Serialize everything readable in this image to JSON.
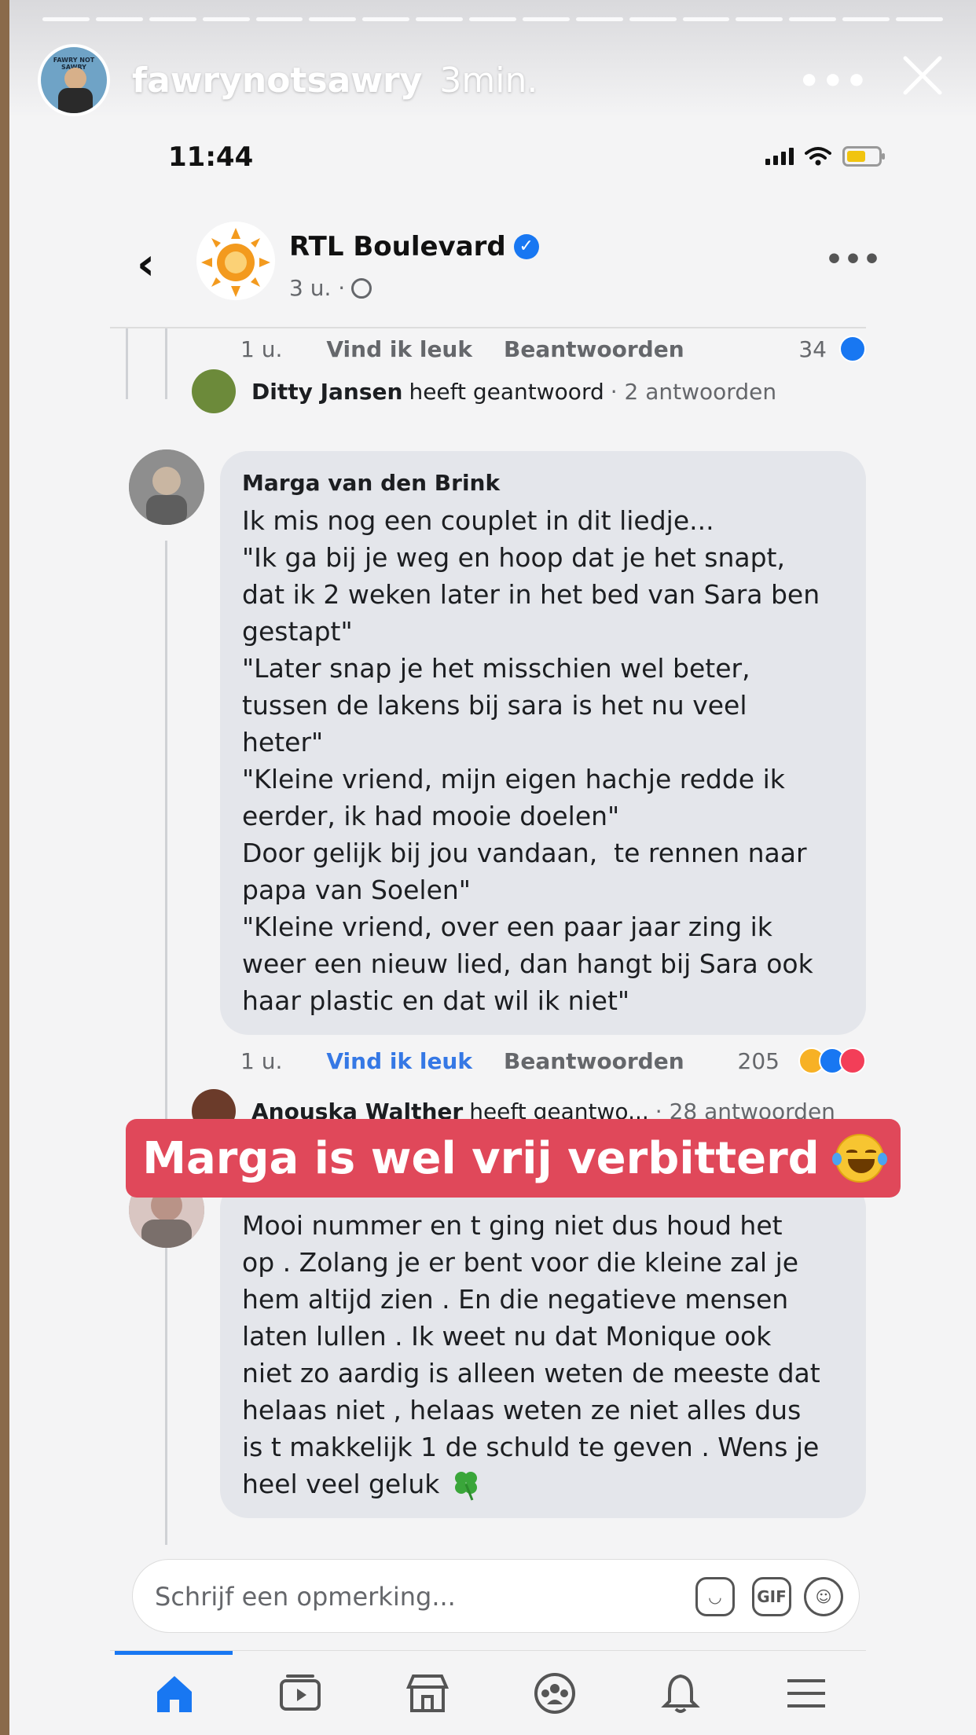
{
  "story": {
    "username": "fawrynotsawry",
    "time_ago": "3min.",
    "avatar_text": "FAWRY NOT SAWRY",
    "more_label": "•••",
    "overlay_text": "Marga is wel vrij verbitterd"
  },
  "status": {
    "clock": "11:44"
  },
  "post": {
    "page_name": "RTL Boulevard",
    "meta": "3 u. ·",
    "back_label": "‹",
    "more_label": "•••"
  },
  "comments": {
    "top_actions": {
      "time": "1 u.",
      "like": "Vind ik leuk",
      "reply": "Beantwoorden",
      "count": "34"
    },
    "reply_summary_1": {
      "name": "Ditty Jansen",
      "text": "heeft geantwoord",
      "count": "· 2 antwoorden"
    },
    "main": {
      "author": "Marga van den Brink",
      "lines": [
        "Ik mis nog een couplet in dit liedje...",
        "\"Ik ga bij je weg en hoop dat je het snapt,",
        "dat ik 2 weken later in het bed van Sara ben",
        "gestapt\"",
        "\"Later snap je het misschien wel beter,",
        "tussen de lakens bij sara is het nu veel",
        "heter\"",
        "\"Kleine vriend, mijn eigen hachje redde ik",
        "eerder, ik had mooie doelen\"",
        "Door gelijk bij jou vandaan,  te rennen naar",
        "papa van Soelen\"",
        "\"Kleine vriend, over een paar jaar zing ik",
        "weer een nieuw lied, dan hangt bij Sara ook",
        "haar plastic en dat wil ik niet\""
      ],
      "actions": {
        "time": "1 u.",
        "like": "Vind ik leuk",
        "reply": "Beantwoorden",
        "count": "205"
      }
    },
    "reply_summary_2": {
      "name": "Anouska Walther",
      "text": "heeft geantwo...",
      "count": "· 28 antwoorden"
    },
    "second": {
      "lines": [
        "Mooi nummer en t ging niet dus houd het",
        "op . Zolang je er bent voor die kleine zal je",
        "hem altijd zien . En die negatieve mensen",
        "laten lullen . Ik weet nu dat Monique ook",
        "niet zo aardig is alleen weten de meeste dat",
        "helaas niet , helaas weten ze niet alles dus",
        "is t makkelijk 1 de schuld te geven . Wens je",
        "heel veel geluk"
      ]
    }
  },
  "composer": {
    "placeholder": "Schrijf een opmerking...",
    "gif_label": "GIF"
  },
  "colors": {
    "facebook_blue": "#1877f2",
    "overlay_red": "#e0485a",
    "bubble_grey": "#e4e6eb",
    "muted": "#65676b"
  },
  "icons": [
    "close-icon",
    "signal-icon",
    "wifi-icon",
    "battery-icon",
    "verified-icon",
    "globe-icon",
    "like-reaction-icon",
    "haha-reaction-icon",
    "love-reaction-icon",
    "clover-emoji-icon",
    "laughing-emoji-icon",
    "sticker-icon",
    "gif-icon",
    "emoji-icon",
    "home-icon",
    "watch-icon",
    "marketplace-icon",
    "groups-icon",
    "bell-icon",
    "menu-icon"
  ]
}
